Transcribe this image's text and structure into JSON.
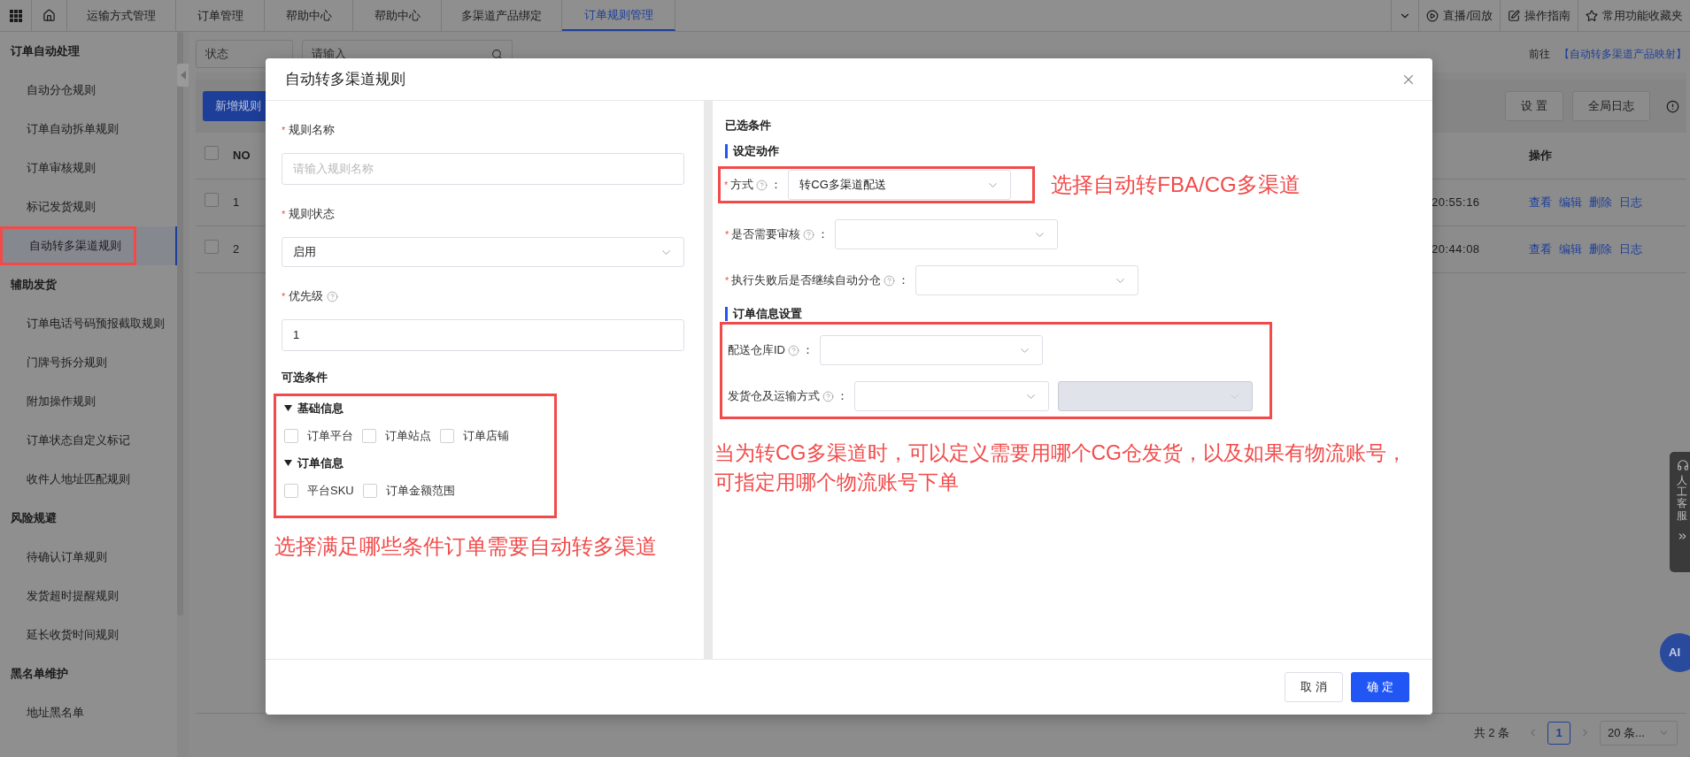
{
  "top_bar": {
    "tabs": [
      {
        "label": "运输方式管理",
        "selected": false
      },
      {
        "label": "订单管理",
        "selected": false
      },
      {
        "label": "帮助中心",
        "selected": false
      },
      {
        "label": "帮助中心",
        "selected": false
      },
      {
        "label": "多渠道产品绑定",
        "selected": false
      },
      {
        "label": "订单规则管理",
        "selected": true
      }
    ],
    "tools": [
      {
        "kind": "play",
        "label": "直播/回放"
      },
      {
        "kind": "guide",
        "label": "操作指南"
      },
      {
        "kind": "star",
        "label": "常用功能收藏夹"
      }
    ]
  },
  "sidebar": {
    "groups": [
      {
        "title": "订单自动处理",
        "items": [
          {
            "label": "自动分仓规则",
            "selected": false,
            "highlighted": false
          },
          {
            "label": "订单自动拆单规则",
            "selected": false,
            "highlighted": false
          },
          {
            "label": "订单审核规则",
            "selected": false,
            "highlighted": false
          },
          {
            "label": "标记发货规则",
            "selected": false,
            "highlighted": false
          },
          {
            "label": "自动转多渠道规则",
            "selected": true,
            "highlighted": true
          }
        ]
      },
      {
        "title": "辅助发货",
        "items": [
          {
            "label": "订单电话号码预报截取规则",
            "selected": false,
            "highlighted": false
          },
          {
            "label": "门牌号拆分规则",
            "selected": false,
            "highlighted": false
          },
          {
            "label": "附加操作规则",
            "selected": false,
            "highlighted": false
          },
          {
            "label": "订单状态自定义标记",
            "selected": false,
            "highlighted": false
          },
          {
            "label": "收件人地址匹配规则",
            "selected": false,
            "highlighted": false
          }
        ]
      },
      {
        "title": "风险规避",
        "items": [
          {
            "label": "待确认订单规则",
            "selected": false,
            "highlighted": false
          },
          {
            "label": "发货超时提醒规则",
            "selected": false,
            "highlighted": false
          },
          {
            "label": "延长收货时间规则",
            "selected": false,
            "highlighted": false
          }
        ]
      },
      {
        "title": "黑名单维护",
        "items": [
          {
            "label": "地址黑名单",
            "selected": false,
            "highlighted": false
          }
        ]
      }
    ]
  },
  "page": {
    "filters": [
      {
        "kind": "select",
        "placeholder": "状态"
      },
      {
        "kind": "search",
        "placeholder": "请输入"
      }
    ],
    "goto_label": "前往",
    "goto_link": "【自动转多渠道产品映射】",
    "add_button": "新增规则",
    "buttons": [
      "设 置",
      "全局日志"
    ],
    "table": {
      "header_checked": false,
      "columns": [
        "NO",
        "操作"
      ],
      "rows": [
        {
          "no": "1",
          "time": "20:55:16",
          "checked": false,
          "actions": [
            "查看",
            "编辑",
            "删除",
            "日志"
          ]
        },
        {
          "no": "2",
          "time": "20:44:08",
          "checked": false,
          "actions": [
            "查看",
            "编辑",
            "删除",
            "日志"
          ]
        }
      ]
    },
    "pagination": {
      "total": "共 2 条",
      "pages": [
        {
          "label": "1",
          "selected": true
        }
      ],
      "page_size": "20 条..."
    }
  },
  "support_widget": {
    "label": "人工客服"
  },
  "ai_button": "AI",
  "dialog": {
    "title": "自动转多渠道规则",
    "label_suffix": "：",
    "required_mark": "*",
    "form": [
      {
        "kind": "input",
        "label": "规则名称",
        "required": true,
        "help": false,
        "placeholder": "请输入规则名称"
      },
      {
        "kind": "select",
        "label": "规则状态",
        "required": true,
        "help": false,
        "value": "启用"
      },
      {
        "kind": "input",
        "label": "优先级",
        "required": true,
        "help": true,
        "value": "1"
      }
    ],
    "optional": {
      "title": "可选条件",
      "highlighted": true,
      "groups": [
        {
          "title": "基础信息",
          "expanded": true,
          "options": [
            {
              "label": "订单平台",
              "checked": false
            },
            {
              "label": "订单站点",
              "checked": false
            },
            {
              "label": "订单店铺",
              "checked": false
            }
          ]
        },
        {
          "title": "订单信息",
          "expanded": true,
          "options": [
            {
              "label": "平台SKU",
              "checked": false
            },
            {
              "label": "订单金额范围",
              "checked": false
            }
          ]
        }
      ],
      "annotation": "选择满足哪些条件订单需要自动转多渠道"
    },
    "selected_title": "已选条件",
    "sections": [
      {
        "title": "设定动作",
        "highlighted": false,
        "fields": [
          {
            "label": "方式",
            "required": true,
            "help": true,
            "highlighted": true,
            "annotation": "选择自动转FBA/CG多渠道",
            "selects": [
              {
                "value": "转CG多渠道配送",
                "disabled": false
              }
            ]
          },
          {
            "label": "是否需要审核",
            "required": true,
            "help": true,
            "highlighted": false,
            "selects": [
              {
                "disabled": false
              }
            ]
          },
          {
            "label": "执行失败后是否继续自动分仓",
            "required": true,
            "help": true,
            "highlighted": false,
            "selects": [
              {
                "disabled": false
              }
            ]
          }
        ]
      },
      {
        "title": "订单信息设置",
        "highlighted": true,
        "annotation_lines": [
          "当为转CG多渠道时，可以定义需要用哪个CG仓发货，以及如果有物流账号，",
          "可指定用哪个物流账号下单"
        ],
        "fields": [
          {
            "label": "配送仓库ID",
            "required": false,
            "help": true,
            "highlighted": false,
            "selects": [
              {
                "disabled": false
              }
            ]
          },
          {
            "label": "发货仓及运输方式",
            "required": false,
            "help": true,
            "highlighted": false,
            "selects": [
              {
                "disabled": false
              },
              {
                "disabled": true
              }
            ]
          }
        ]
      }
    ],
    "footer": [
      {
        "kind": "default",
        "label": "取 消"
      },
      {
        "kind": "primary",
        "label": "确 定"
      }
    ]
  }
}
